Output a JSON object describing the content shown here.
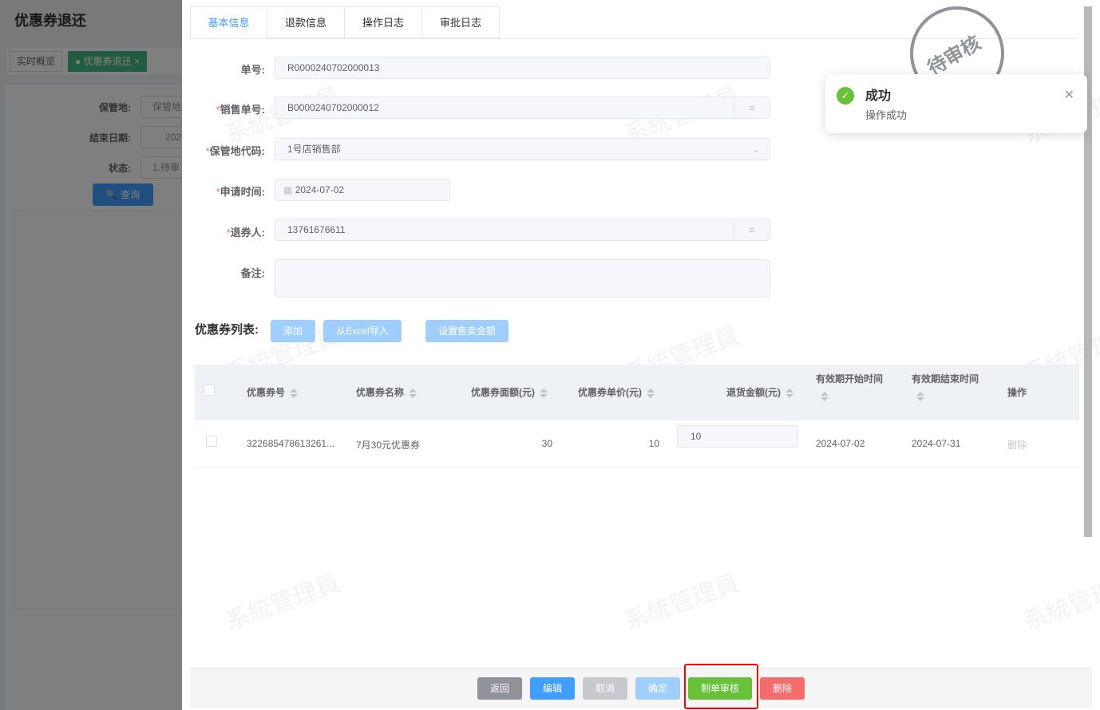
{
  "background": {
    "title": "优惠券退还",
    "tags": [
      "实时概览",
      "优惠券退还"
    ],
    "filters": [
      {
        "label": "保管地:",
        "value": "保管地"
      },
      {
        "label": "结束日期:",
        "value": "202"
      },
      {
        "label": "状态:",
        "value": "1.待审"
      }
    ],
    "query_button": "查询"
  },
  "drawer": {
    "tabs": [
      "基本信息",
      "退款信息",
      "操作日志",
      "审批日志"
    ],
    "stamp": "待审核",
    "form": {
      "order_no": {
        "label": "单号:",
        "value": "R0000240702000013"
      },
      "sale_no": {
        "label": "销售单号:",
        "value": "B0000240702000012"
      },
      "location": {
        "label": "保管地代码:",
        "value": "1号店销售部"
      },
      "apply_time": {
        "label": "申请时间:",
        "value": "2024-07-02"
      },
      "refunder": {
        "label": "退券人:",
        "value": "13761676611"
      },
      "remark": {
        "label": "备注:",
        "value": ""
      }
    },
    "coupon_list": {
      "label": "优惠券列表:",
      "buttons": [
        "添加",
        "从Excel导入",
        "设置售卖金额"
      ]
    },
    "table": {
      "headers": [
        "优惠券号",
        "优惠券名称",
        "优惠券面额(元)",
        "优惠券单价(元)",
        "退货金额(元)",
        "有效期开始时间",
        "有效期结束时间",
        "操作"
      ],
      "rows": [
        {
          "no": "322685478613261...",
          "name": "7月30元优惠券",
          "face": "30",
          "price": "10",
          "refund": "10",
          "start": "2024-07-02",
          "end": "2024-07-31",
          "action": "删除"
        }
      ]
    },
    "footer": [
      "返回",
      "编辑",
      "取消",
      "确定",
      "制单审核",
      "删除"
    ],
    "watermark": "系統管理員"
  },
  "toast": {
    "title": "成功",
    "message": "操作成功"
  },
  "colors": {
    "primary": "#409eff",
    "success": "#67c23a",
    "danger": "#f56c6c",
    "highlight": "#ff0000"
  }
}
